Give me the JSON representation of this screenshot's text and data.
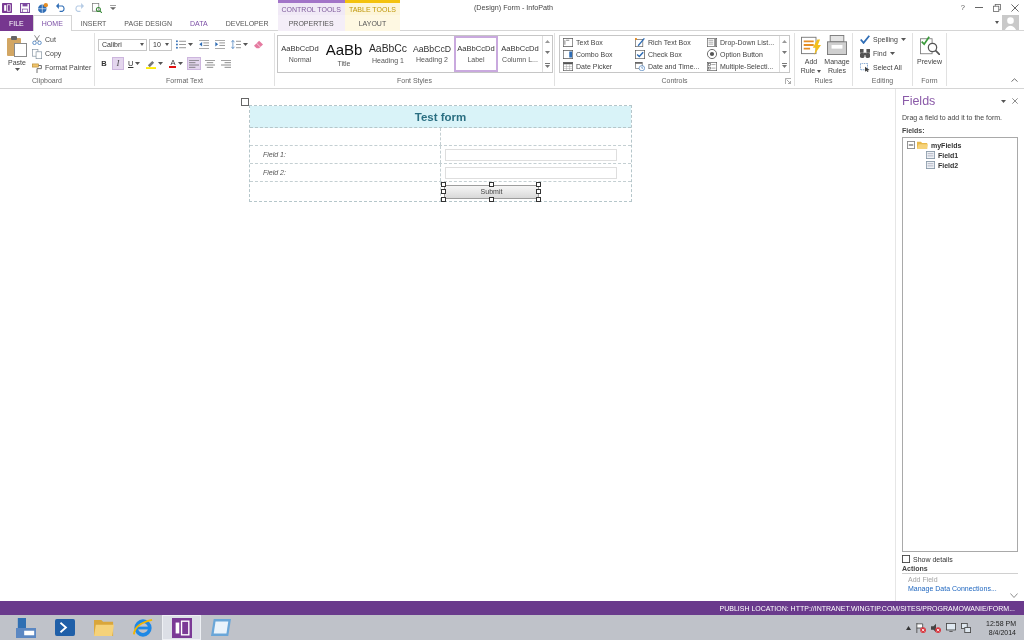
{
  "window": {
    "title": "(Design) Form - InfoPath",
    "help": "?"
  },
  "quick_access": [
    {
      "kind": "logo",
      "disabled": false
    },
    {
      "kind": "save",
      "disabled": false
    },
    {
      "kind": "publish",
      "disabled": false
    },
    {
      "kind": "undo",
      "disabled": false
    },
    {
      "kind": "redo",
      "disabled": true
    },
    {
      "kind": "preview",
      "disabled": false
    },
    {
      "kind": "customize",
      "disabled": false
    }
  ],
  "tabs": [
    {
      "label": "FILE",
      "kind": "file",
      "selected": false,
      "hovered": false
    },
    {
      "label": "HOME",
      "kind": "main",
      "selected": true,
      "hovered": false
    },
    {
      "label": "INSERT",
      "kind": "main",
      "selected": false,
      "hovered": false
    },
    {
      "label": "PAGE DESIGN",
      "kind": "main",
      "selected": false,
      "hovered": false
    },
    {
      "label": "DATA",
      "kind": "main",
      "selected": false,
      "hovered": true
    },
    {
      "label": "DEVELOPER",
      "kind": "main",
      "selected": false,
      "hovered": false
    }
  ],
  "contextual_tabs": [
    {
      "group": "CONTROL TOOLS",
      "color": "#a274c8",
      "tabs": [
        {
          "label": "PROPERTIES",
          "selected": false
        }
      ]
    },
    {
      "group": "TABLE TOOLS",
      "color": "#f4c20d",
      "tabs": [
        {
          "label": "LAYOUT",
          "selected": false
        }
      ]
    }
  ],
  "ribbon": {
    "clipboard": {
      "label": "Clipboard",
      "paste": {
        "label": "Paste",
        "dropdown": true
      },
      "actions": [
        {
          "kind": "cut",
          "label": "Cut"
        },
        {
          "kind": "copy",
          "label": "Copy"
        },
        {
          "kind": "painter",
          "label": "Format Painter"
        }
      ]
    },
    "format_text": {
      "label": "Format Text",
      "font": "Calibri",
      "size": "10",
      "row_1": [
        {
          "kind": "bullets",
          "dropdown": true
        },
        {
          "kind": "outdent",
          "dropdown": false
        },
        {
          "kind": "indent",
          "dropdown": false
        },
        {
          "kind": "spacing",
          "dropdown": true
        },
        {
          "kind": "clear",
          "dropdown": false
        }
      ],
      "row_2": [
        {
          "kind": "bold",
          "text": "B",
          "selected": false,
          "dropdown": false
        },
        {
          "kind": "italic",
          "text": "I",
          "selected": true,
          "dropdown": false
        },
        {
          "kind": "underline",
          "text": "U",
          "selected": false,
          "dropdown": true
        },
        {
          "kind": "highlight",
          "selected": false,
          "dropdown": true
        },
        {
          "kind": "color",
          "text": "A",
          "selected": false,
          "dropdown": true
        },
        {
          "kind": "left",
          "selected": true,
          "dropdown": false
        },
        {
          "kind": "center",
          "selected": false,
          "dropdown": false
        },
        {
          "kind": "right",
          "selected": false,
          "dropdown": false
        }
      ]
    },
    "font_styles": {
      "label": "Font Styles",
      "styles": [
        {
          "kind": "normal",
          "sample": "AaBbCcDd",
          "name": "Normal",
          "selected": false
        },
        {
          "kind": "title",
          "sample": "AaBb",
          "name": "Title",
          "selected": false
        },
        {
          "kind": "heading1",
          "sample": "AaBbCc",
          "name": "Heading 1",
          "selected": false
        },
        {
          "kind": "heading2",
          "sample": "AaBbCcD",
          "name": "Heading 2",
          "selected": false
        },
        {
          "kind": "label",
          "sample": "AaBbCcDd",
          "name": "Label",
          "selected": true
        },
        {
          "kind": "column",
          "sample": "AaBbCcDd",
          "name": "Column L...",
          "selected": false
        }
      ]
    },
    "controls": {
      "label": "Controls",
      "items": [
        {
          "kind": "textbox",
          "label": "Text Box"
        },
        {
          "kind": "combobox",
          "label": "Combo Box"
        },
        {
          "kind": "datepicker",
          "label": "Date Picker"
        },
        {
          "kind": "richtext",
          "label": "Rich Text Box"
        },
        {
          "kind": "checkbox",
          "label": "Check Box"
        },
        {
          "kind": "datetime",
          "label": "Date and Time..."
        },
        {
          "kind": "dropdown",
          "label": "Drop-Down List..."
        },
        {
          "kind": "option",
          "label": "Option Button"
        },
        {
          "kind": "multiselect",
          "label": "Multiple-Selecti..."
        }
      ]
    },
    "rules": {
      "label": "Rules",
      "buttons": [
        {
          "kind": "addrule",
          "label": "Add Rule",
          "dropdown": true
        },
        {
          "kind": "managerules",
          "label": "Manage Rules",
          "dropdown": false
        }
      ]
    },
    "editing": {
      "label": "Editing",
      "buttons": [
        {
          "kind": "spelling",
          "label": "Spelling",
          "dropdown": true
        },
        {
          "kind": "find",
          "label": "Find",
          "dropdown": true
        },
        {
          "kind": "selectall",
          "label": "Select All",
          "dropdown": false
        }
      ]
    },
    "form": {
      "label": "Form",
      "buttons": [
        {
          "kind": "bigpreview",
          "label": "Preview"
        }
      ]
    }
  },
  "form": {
    "title": "Test form",
    "fields": [
      {
        "label": "Field 1:"
      },
      {
        "label": "Field 2:"
      }
    ],
    "submit": {
      "label": "Submit",
      "selected": true
    }
  },
  "fields_pane": {
    "title": "Fields",
    "hint": "Drag a field to add it to the form.",
    "tree_label": "Fields:",
    "tree": [
      {
        "label": "myFields",
        "kind": "group",
        "expanded": true,
        "children": [
          {
            "label": "Field1",
            "kind": "field"
          },
          {
            "label": "Field2",
            "kind": "field"
          }
        ]
      }
    ],
    "show_details": {
      "label": "Show details",
      "checked": false
    },
    "actions_title": "Actions",
    "actions": [
      {
        "label": "Add Field",
        "disabled": true
      },
      {
        "label": "Manage Data Connections...",
        "disabled": false
      }
    ]
  },
  "status_bar": {
    "text": "PUBLISH LOCATION: HTTP://INTRANET.WINGTIP.COM/SITES/PROGRAMOWANIE/FORM..."
  },
  "taskbar": {
    "apps": [
      {
        "kind": "server",
        "selected": false
      },
      {
        "kind": "shell",
        "selected": false
      },
      {
        "kind": "folder",
        "selected": false
      },
      {
        "kind": "ring",
        "selected": false
      },
      {
        "kind": "infopath",
        "selected": true
      },
      {
        "kind": "notes",
        "selected": false
      }
    ],
    "time": "12:58 PM",
    "date": "8/4/2014"
  }
}
